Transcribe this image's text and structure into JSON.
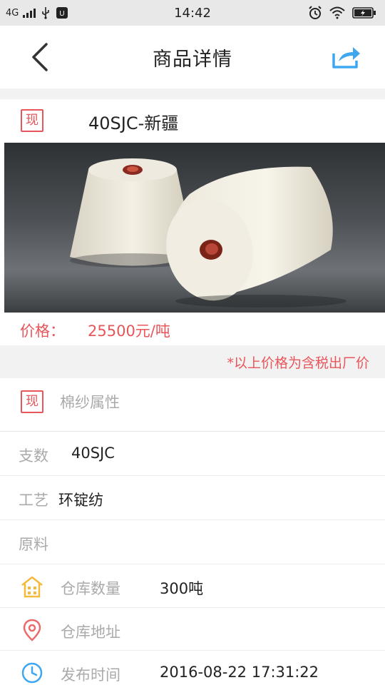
{
  "status_bar": {
    "network": "4G",
    "time": "14:42"
  },
  "header": {
    "title": "商品详情",
    "back_icon": "chevron-left-icon",
    "share_icon": "share-icon",
    "accent_color": "#3fa7f0"
  },
  "product": {
    "tag": "现",
    "name": "40SJC-新疆",
    "price_label": "价格：",
    "price_value": "25500元/吨",
    "price_note": "*以上价格为含税出厂价",
    "accent_color": "#e8555a"
  },
  "attributes": {
    "tag": "现",
    "title": "棉纱属性",
    "rows": [
      {
        "label": "支数",
        "value": "40SJC"
      },
      {
        "label": "工艺",
        "value": "环锭纺"
      },
      {
        "label": "原料",
        "value": ""
      }
    ]
  },
  "warehouse": {
    "qty_label": "仓库数量",
    "qty_value": "300吨",
    "addr_label": "仓库地址",
    "addr_value": "",
    "time_label": "发布时间",
    "time_value": "2016-08-22 17:31:22",
    "icons": [
      "warehouse-icon",
      "location-pin-icon",
      "clock-icon"
    ]
  }
}
